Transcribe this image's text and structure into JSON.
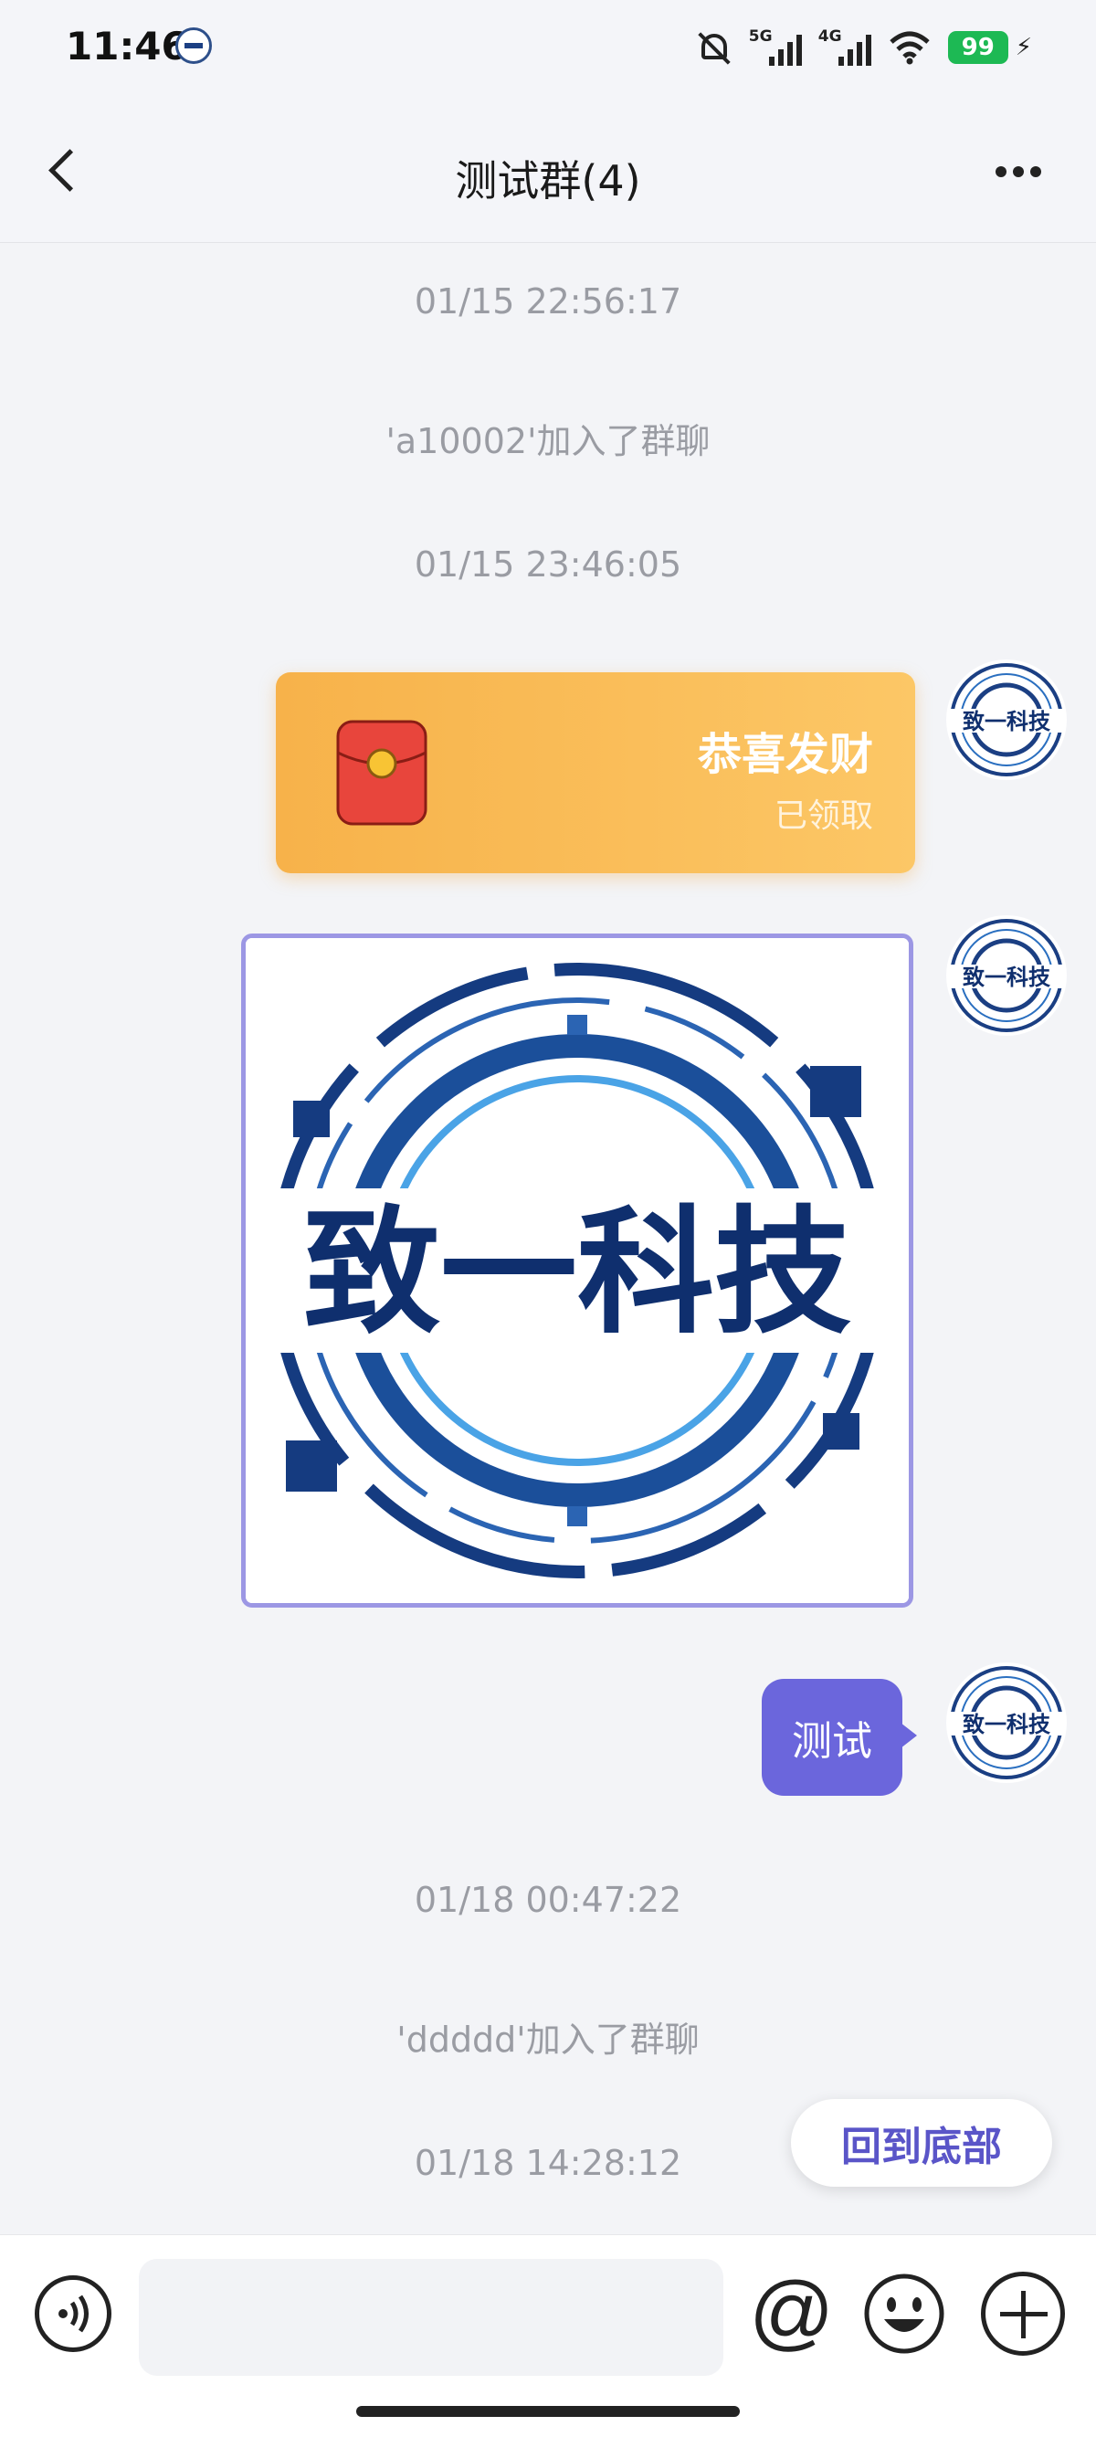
{
  "status_bar": {
    "time": "11:46",
    "network_1": "5G",
    "network_2": "4G",
    "battery": "99"
  },
  "header": {
    "title": "测试群(4)"
  },
  "messages": {
    "time_1": "01/15 22:56:17",
    "system_1": "'a10002'加入了群聊",
    "time_2": "01/15 23:46:05",
    "red_packet": {
      "title": "恭喜发财",
      "status": "已领取"
    },
    "image_logo_text": "致一科技",
    "text_1": "测试",
    "time_3": "01/18 00:47:22",
    "system_2": "'ddddd'加入了群聊",
    "time_4": "01/18 14:28:12"
  },
  "back_to_bottom": "回到底部",
  "input": {
    "placeholder": "",
    "at_symbol": "@"
  },
  "colors": {
    "accent": "#6b66dc",
    "red_packet": "#fbbf5c",
    "logo_blue": "#1b3f83"
  },
  "icons": {
    "back": "chevron-left-icon",
    "more": "more-dots-icon",
    "voice": "voice-icon",
    "emoji": "emoji-icon",
    "plus": "plus-icon"
  }
}
